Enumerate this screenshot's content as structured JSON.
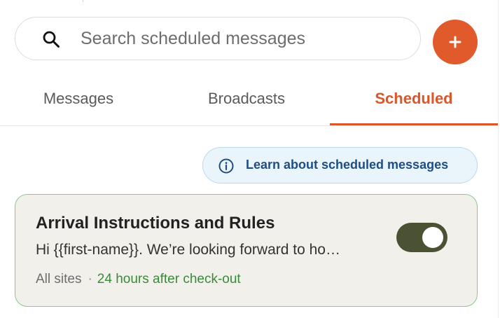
{
  "search": {
    "placeholder": "Search scheduled messages",
    "icon": "search-icon"
  },
  "add_button": {
    "label": "+",
    "color": "#e05a2b"
  },
  "tabs": [
    {
      "label": "Messages",
      "active": false
    },
    {
      "label": "Broadcasts",
      "active": false
    },
    {
      "label": "Scheduled",
      "active": true
    }
  ],
  "accent_color": "#d9572a",
  "info_link": {
    "label": "Learn about scheduled messages",
    "icon": "info-icon"
  },
  "scheduled_messages": [
    {
      "title": "Arrival Instructions and Rules",
      "preview": "Hi {{first-name}}. We’re looking forward to ho…",
      "sites": "All sites",
      "separator": "·",
      "timing": "24 hours after check-out",
      "enabled": true
    }
  ]
}
